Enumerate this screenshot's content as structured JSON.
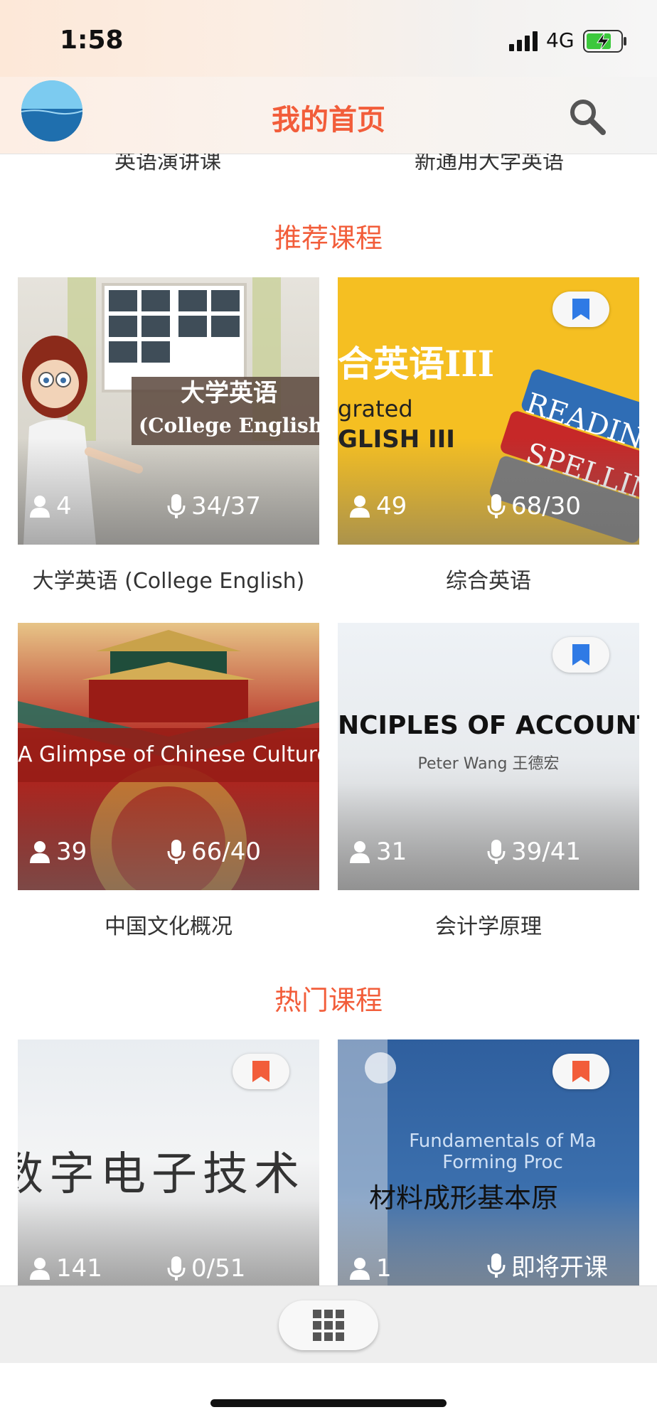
{
  "status_bar": {
    "time": "1:58",
    "network": "4G",
    "battery_icon": "battery-charging-icon",
    "signal_icon": "signal-bars-icon"
  },
  "nav": {
    "title": "我的首页",
    "avatar_icon": "avatar-icon",
    "search_icon": "search-icon"
  },
  "previous_row": {
    "left_title": "英语演讲课",
    "right_title": "新通用大学英语"
  },
  "recommended": {
    "title": "推荐课程",
    "cards": [
      {
        "title": "大学英语 (College English)",
        "thumb_text_1": "大学英语",
        "thumb_text_2": "(College English)",
        "students": "4",
        "lessons": "34/37",
        "bookmarked": false
      },
      {
        "title": "综合英语",
        "thumb_text_1": "合英语III",
        "thumb_text_2": "grated",
        "thumb_text_3": "GLISH III",
        "students": "49",
        "lessons": "68/30",
        "bookmarked": true,
        "bookmark_color": "#2f7ae5"
      },
      {
        "title": "中国文化概况",
        "thumb_text_1": "A Glimpse of Chinese Culture",
        "students": "39",
        "lessons": "66/40",
        "bookmarked": false
      },
      {
        "title": "会计学原理",
        "thumb_text_1": "NCIPLES OF ACCOUNT",
        "thumb_text_2": "Peter Wang 王德宏",
        "students": "31",
        "lessons": "39/41",
        "bookmarked": true,
        "bookmark_color": "#2f7ae5"
      }
    ]
  },
  "popular": {
    "title": "热门课程",
    "cards": [
      {
        "thumb_text_1": "数字电子技术",
        "students": "141",
        "lessons": "0/51",
        "bookmarked": true,
        "bookmark_color": "#f25d3a"
      },
      {
        "thumb_text_1": "Fundamentals of Ma",
        "thumb_text_2": "Forming Proc",
        "thumb_text_3": "材料成形基本原",
        "students": "1",
        "lessons": "即将开课",
        "bookmarked": true,
        "bookmark_color": "#f25d3a"
      }
    ]
  },
  "bottom_bar": {
    "menu_icon": "grid-menu-icon"
  },
  "colors": {
    "accent": "#f25d3a",
    "bookmark_blue": "#2f7ae5"
  }
}
